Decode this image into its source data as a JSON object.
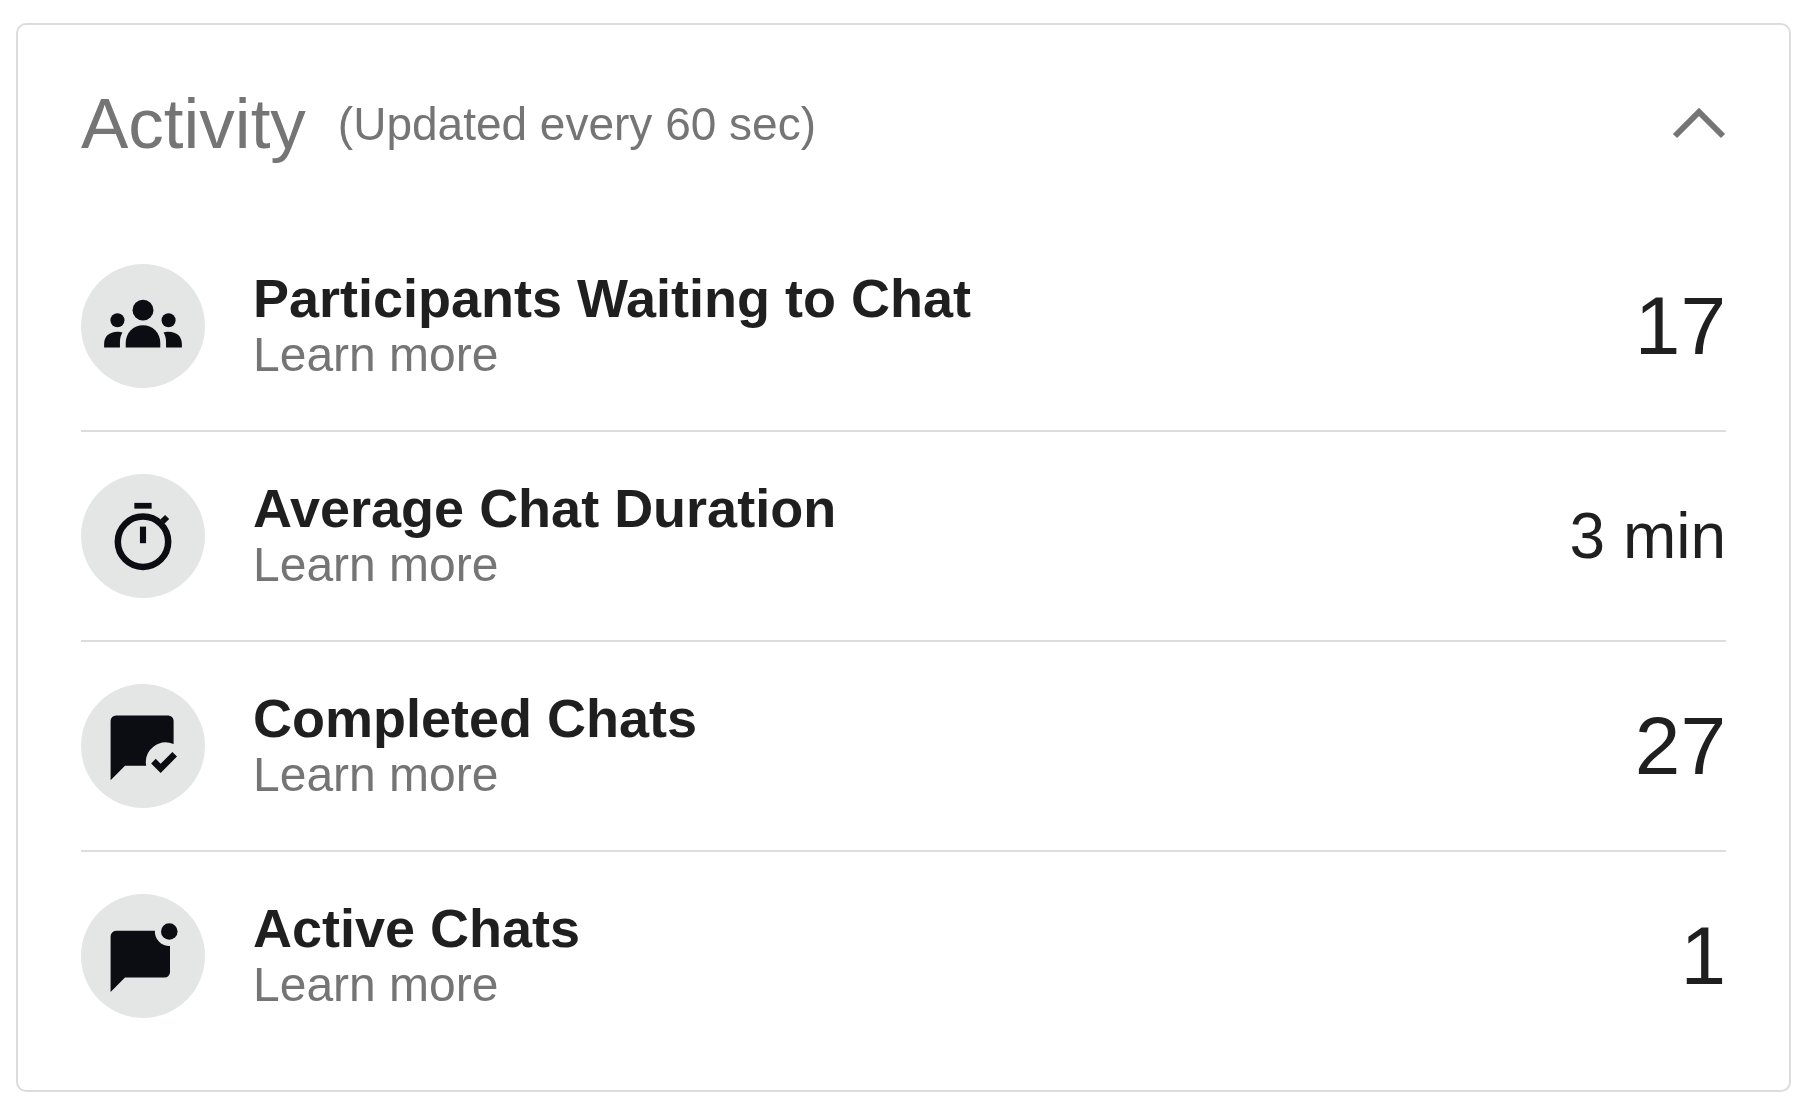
{
  "panel": {
    "title": "Activity",
    "subtitle": "(Updated every 60 sec)",
    "expanded": true
  },
  "metrics": [
    {
      "kind": "count",
      "title": "Participants Waiting to Chat",
      "link": "Learn more",
      "value": "17"
    },
    {
      "kind": "duration",
      "title": "Average Chat Duration",
      "link": "Learn more",
      "value": "3 min"
    },
    {
      "kind": "count",
      "title": "Completed Chats",
      "link": "Learn more",
      "value": "27"
    },
    {
      "kind": "count",
      "title": "Active Chats",
      "link": "Learn more",
      "value": "1"
    }
  ]
}
